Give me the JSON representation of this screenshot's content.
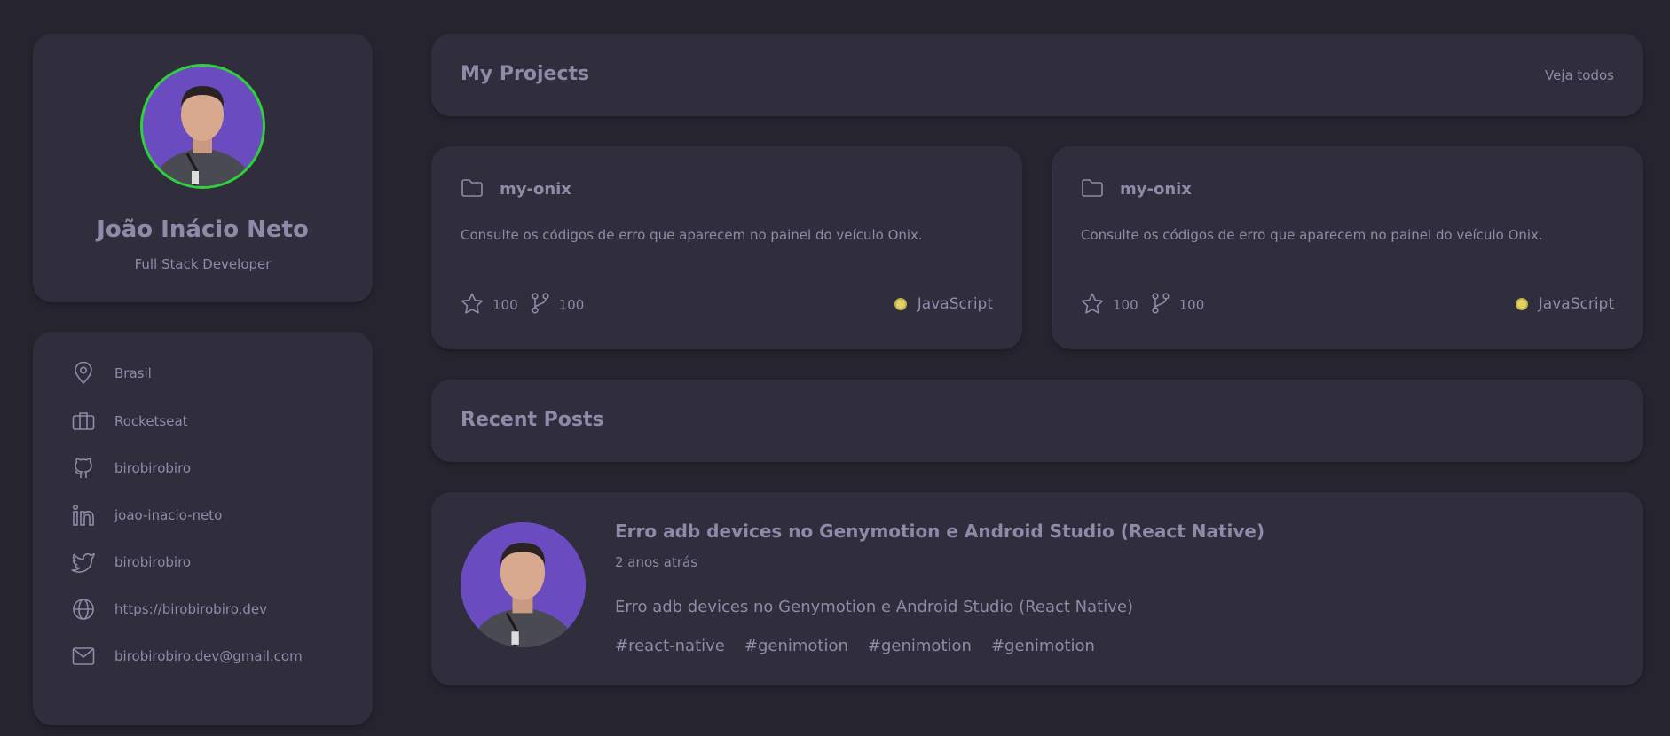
{
  "profile": {
    "name": "João Inácio Neto",
    "role": "Full Stack Developer",
    "avatar_ring_color": "#2ed13a"
  },
  "info": [
    {
      "icon": "location-pin-icon",
      "text": "Brasil"
    },
    {
      "icon": "briefcase-icon",
      "text": "Rocketseat"
    },
    {
      "icon": "github-icon",
      "text": "birobirobiro"
    },
    {
      "icon": "linkedin-icon",
      "text": "joao-inacio-neto"
    },
    {
      "icon": "twitter-icon",
      "text": "birobirobiro"
    },
    {
      "icon": "globe-icon",
      "text": "https://birobirobiro.dev"
    },
    {
      "icon": "mail-icon",
      "text": "birobirobiro.dev@gmail.com"
    }
  ],
  "projects": {
    "title": "My Projects",
    "see_all": "Veja todos",
    "items": [
      {
        "name": "my-onix",
        "description": "Consulte os códigos de erro que aparecem no painel do veículo Onix.",
        "stars": "100",
        "forks": "100",
        "language": "JavaScript",
        "language_color": "#e3d462"
      },
      {
        "name": "my-onix",
        "description": "Consulte os códigos de erro que aparecem no painel do veículo Onix.",
        "stars": "100",
        "forks": "100",
        "language": "JavaScript",
        "language_color": "#e3d462"
      }
    ]
  },
  "posts": {
    "title": "Recent Posts",
    "items": [
      {
        "title": "Erro adb devices no Genymotion e Android Studio (React Native)",
        "time": "2 anos atrás",
        "body": "Erro adb devices no Genymotion e Android Studio (React Native)",
        "tags": [
          "#react-native",
          "#genimotion",
          "#genimotion",
          "#genimotion"
        ]
      }
    ]
  },
  "theme": {
    "background": "#26242f",
    "card": "#302e3d",
    "text": "#8f8aa8",
    "avatar_bg": "#6a4cc0"
  }
}
